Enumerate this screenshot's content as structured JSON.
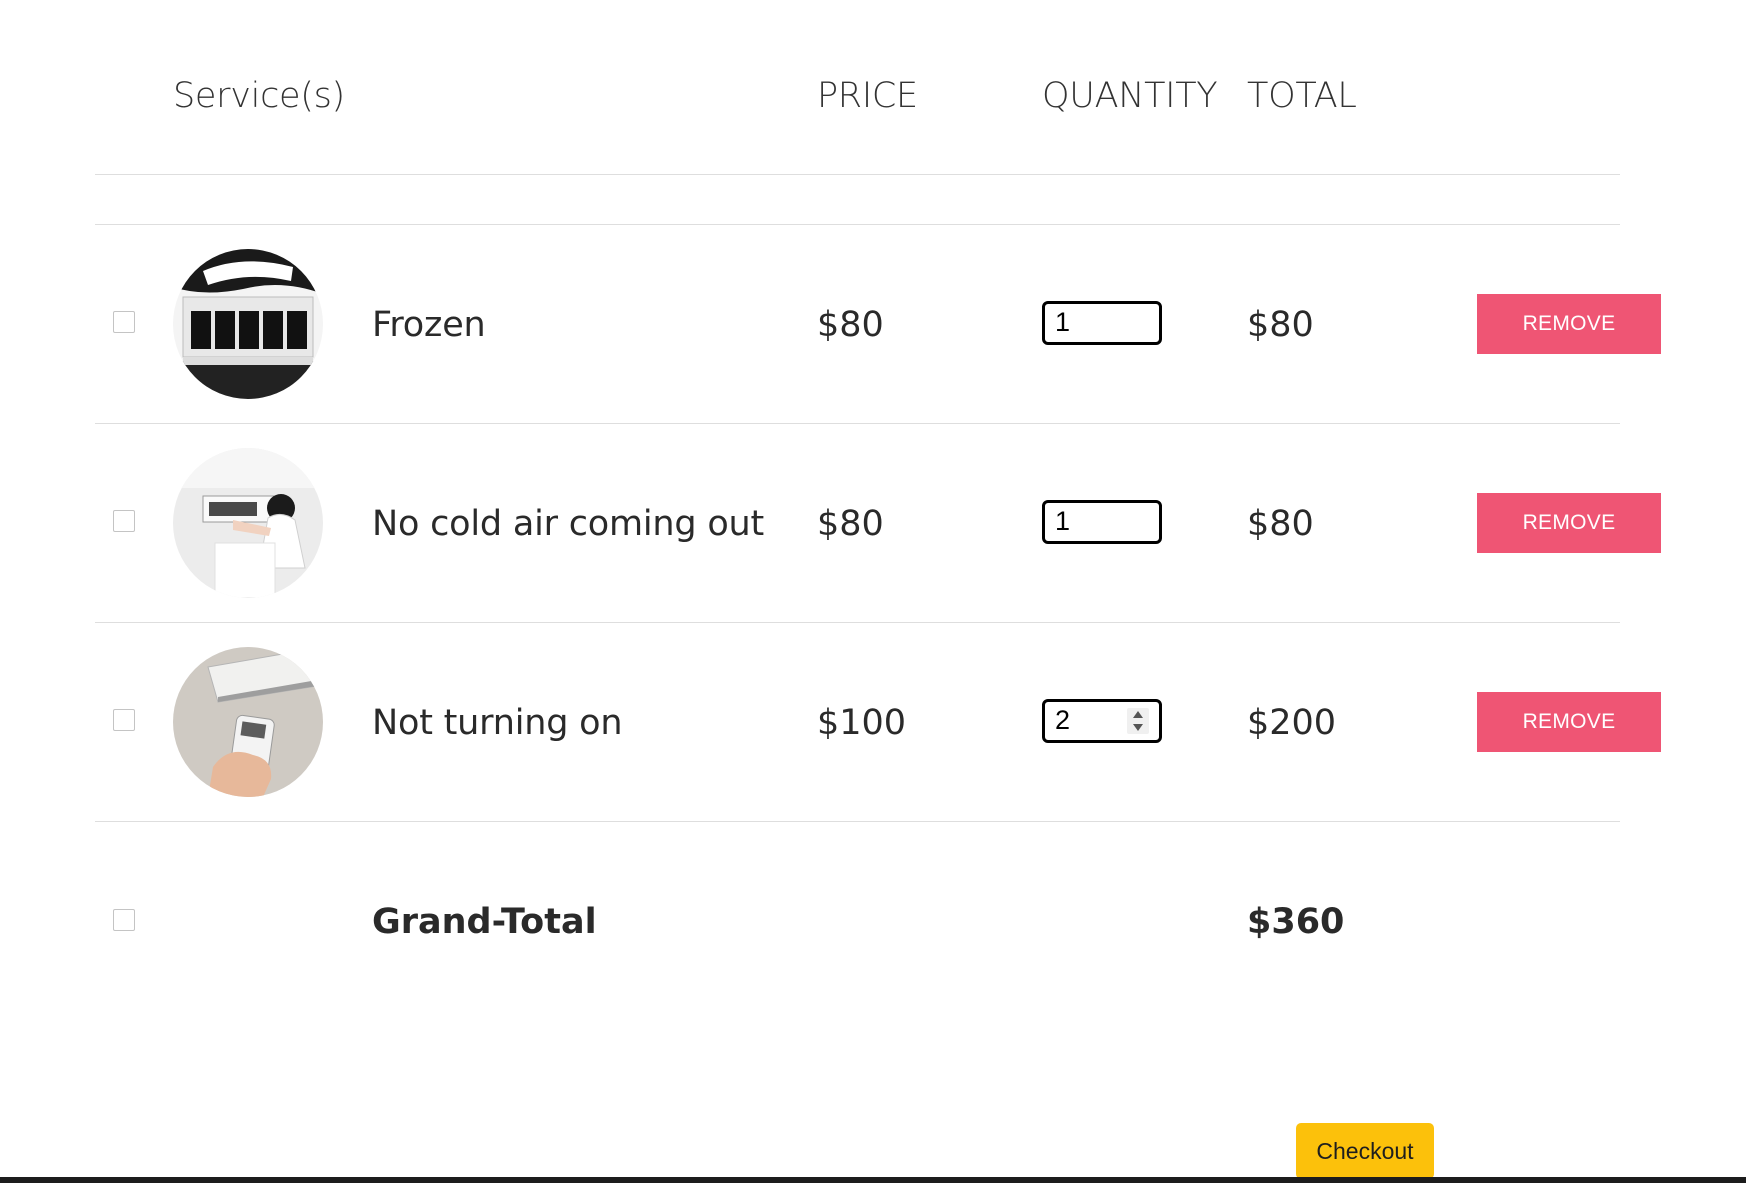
{
  "header": {
    "services": "Service(s)",
    "price": "PRICE",
    "quantity": "QUANTITY",
    "total": "TOTAL"
  },
  "items": [
    {
      "name": "Frozen",
      "price": "$80",
      "quantity": "1",
      "total": "$80",
      "remove_label": "REMOVE",
      "image_icon": "ac-unit-frozen-photo"
    },
    {
      "name": "No cold air coming out",
      "price": "$80",
      "quantity": "1",
      "total": "$80",
      "remove_label": "REMOVE",
      "image_icon": "ac-technician-photo"
    },
    {
      "name": "Not turning on",
      "price": "$100",
      "quantity": "2",
      "total": "$200",
      "remove_label": "REMOVE",
      "image_icon": "ac-remote-photo"
    }
  ],
  "grand_total": {
    "label": "Grand-Total",
    "value": "$360"
  },
  "checkout_label": "Checkout",
  "colors": {
    "remove_button": "#ef5574",
    "checkout_button": "#fcc10b"
  }
}
